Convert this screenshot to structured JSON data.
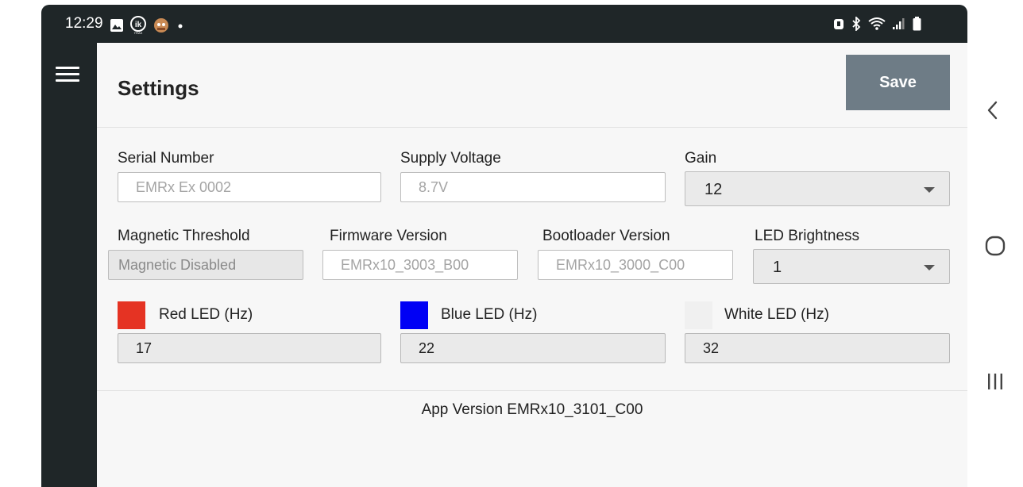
{
  "status_bar": {
    "time": "12:29",
    "left_icons": [
      "gallery-icon",
      "ik-trax-icon",
      "app-avatar-icon",
      "dot-icon"
    ],
    "right_icons": [
      "alarm-icon",
      "bluetooth-icon",
      "wifi-icon",
      "signal-icon",
      "battery-icon"
    ]
  },
  "header": {
    "title": "Settings",
    "save_label": "Save"
  },
  "fields": {
    "serial_number": {
      "label": "Serial Number",
      "value": "EMRx Ex 0002"
    },
    "supply_voltage": {
      "label": "Supply Voltage",
      "value": "8.7V"
    },
    "gain": {
      "label": "Gain",
      "value": "12"
    },
    "magnetic_threshold": {
      "label": "Magnetic Threshold",
      "value": "Magnetic Disabled"
    },
    "firmware_version": {
      "label": "Firmware Version",
      "value": "EMRx10_3003_B00"
    },
    "bootloader_version": {
      "label": "Bootloader Version",
      "value": "EMRx10_3000_C00"
    },
    "led_brightness": {
      "label": "LED Brightness",
      "value": "1"
    },
    "red_led": {
      "label": "Red LED (Hz)",
      "value": "17",
      "color": "#e53323"
    },
    "blue_led": {
      "label": "Blue LED (Hz)",
      "value": "22",
      "color": "#0000f5"
    },
    "white_led": {
      "label": "White LED (Hz)",
      "value": "32",
      "color": "#f0f0f0"
    }
  },
  "footer": {
    "app_version": "App Version EMRx10_3101_C00"
  },
  "nav_bar": {
    "icons": [
      "back-icon",
      "home-icon",
      "recent-apps-icon"
    ]
  },
  "colors": {
    "frame": "#1f2628",
    "content_bg": "#f7f7f7",
    "save_button": "#6e7c86"
  }
}
